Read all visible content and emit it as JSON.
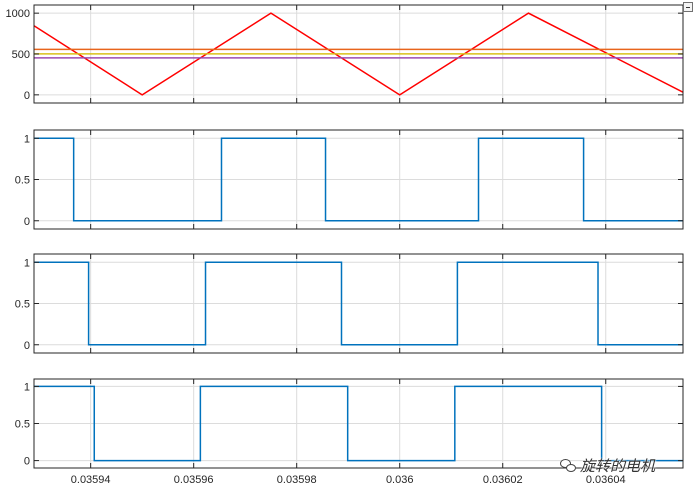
{
  "chart_data": [
    {
      "type": "line",
      "xlim": [
        0.035929,
        0.036055
      ],
      "ylim": [
        -100,
        1100
      ],
      "yticks": [
        0,
        500,
        1000
      ],
      "ytick_labels": [
        "0",
        "500",
        "1000"
      ],
      "xticks": [
        0.03594,
        0.03596,
        0.03598,
        0.036,
        0.03602,
        0.03604
      ],
      "xtick_labels": [
        "",
        "",
        "",
        "",
        "",
        ""
      ],
      "grid": true,
      "series": [
        {
          "color": "#ff0000",
          "x": [
            0.035929,
            0.03595,
            0.035975,
            0.036,
            0.036025,
            0.036055
          ],
          "y": [
            846,
            0,
            1000,
            0,
            1000,
            32
          ]
        },
        {
          "color": "#e8641c",
          "x": [
            0.035929,
            0.036055
          ],
          "y": [
            557,
            557
          ]
        },
        {
          "color": "#d9c01a",
          "x": [
            0.035929,
            0.036055
          ],
          "y": [
            502,
            502
          ]
        },
        {
          "color": "#9b4bb0",
          "x": [
            0.035929,
            0.036055
          ],
          "y": [
            452,
            452
          ]
        }
      ]
    },
    {
      "type": "line",
      "xlim": [
        0.035929,
        0.036055
      ],
      "ylim": [
        -0.1,
        1.1
      ],
      "yticks": [
        0,
        0.5,
        1
      ],
      "ytick_labels": [
        "0",
        "0.5",
        "1"
      ],
      "xticks": [
        0.03594,
        0.03596,
        0.03598,
        0.036,
        0.03602,
        0.03604
      ],
      "xtick_labels": [
        "",
        "",
        "",
        "",
        "",
        ""
      ],
      "grid": true,
      "series": [
        {
          "color": "#0072bd",
          "step": true,
          "transitions": [
            0.0359367,
            0.0359654,
            0.0359856,
            0.0360153,
            0.0360357
          ],
          "y0": 1
        }
      ]
    },
    {
      "type": "line",
      "xlim": [
        0.035929,
        0.036055
      ],
      "ylim": [
        -0.1,
        1.1
      ],
      "yticks": [
        0,
        0.5,
        1
      ],
      "ytick_labels": [
        "0",
        "0.5",
        "1"
      ],
      "xticks": [
        0.03594,
        0.03596,
        0.03598,
        0.036,
        0.03602,
        0.03604
      ],
      "xtick_labels": [
        "",
        "",
        "",
        "",
        "",
        ""
      ],
      "grid": true,
      "series": [
        {
          "color": "#0072bd",
          "step": true,
          "transitions": [
            0.0359396,
            0.0359623,
            0.0359887,
            0.0360112,
            0.0360385
          ],
          "y0": 1
        }
      ]
    },
    {
      "type": "line",
      "xlim": [
        0.035929,
        0.036055
      ],
      "ylim": [
        -0.1,
        1.1
      ],
      "yticks": [
        0,
        0.5,
        1
      ],
      "ytick_labels": [
        "0",
        "0.5",
        "1"
      ],
      "xticks": [
        0.03594,
        0.03596,
        0.03598,
        0.036,
        0.03602,
        0.03604
      ],
      "xtick_labels": [
        "0.03594",
        "0.03596",
        "0.03598",
        "0.036",
        "0.03602",
        "0.03604"
      ],
      "grid": true,
      "series": [
        {
          "color": "#0072bd",
          "step": true,
          "transitions": [
            0.0359407,
            0.0359613,
            0.0359899,
            0.0360107,
            0.0360392
          ],
          "y0": 1
        }
      ]
    }
  ],
  "watermark": {
    "text": "旋转的电机",
    "icon": "wechat-icon"
  }
}
